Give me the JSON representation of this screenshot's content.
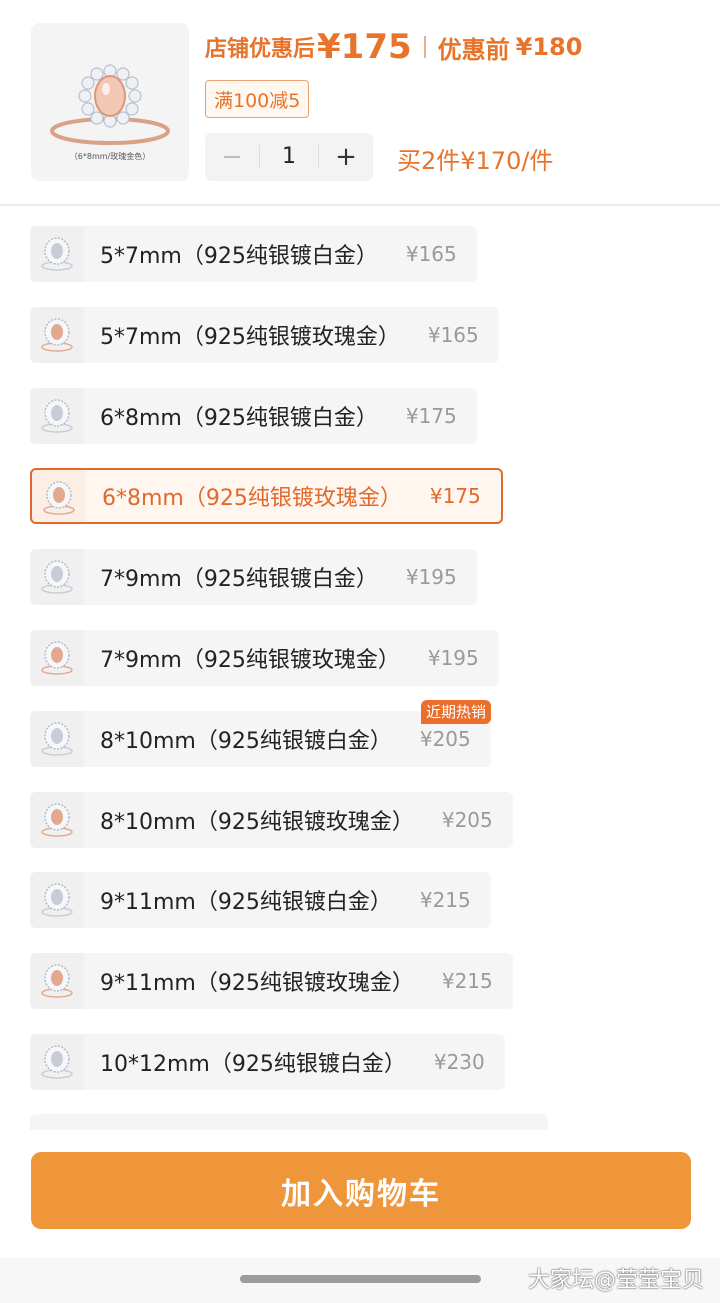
{
  "header": {
    "thumb_caption": "（6*8mm/玫瑰金色）",
    "discount_label": "店铺优惠后",
    "discount_price": "¥175",
    "original_label": "优惠前",
    "original_price": "¥180",
    "coupon": "满100减5",
    "quantity": "1",
    "minus": "−",
    "plus": "+",
    "bulk_offer": "买2件¥170/件"
  },
  "options": [
    {
      "name": "5*7mm（925纯银镀白金）",
      "price": "¥165",
      "tone": "silver",
      "selected": false
    },
    {
      "name": "5*7mm（925纯银镀玫瑰金）",
      "price": "¥165",
      "tone": "rose",
      "selected": false
    },
    {
      "name": "6*8mm（925纯银镀白金）",
      "price": "¥175",
      "tone": "silver",
      "selected": false
    },
    {
      "name": "6*8mm（925纯银镀玫瑰金）",
      "price": "¥175",
      "tone": "rose",
      "selected": true
    },
    {
      "name": "7*9mm（925纯银镀白金）",
      "price": "¥195",
      "tone": "silver",
      "selected": false
    },
    {
      "name": "7*9mm（925纯银镀玫瑰金）",
      "price": "¥195",
      "tone": "rose",
      "selected": false
    },
    {
      "name": "8*10mm（925纯银镀白金）",
      "price": "¥205",
      "tone": "silver",
      "selected": false
    },
    {
      "name": "8*10mm（925纯银镀玫瑰金）",
      "price": "¥205",
      "tone": "rose",
      "selected": false
    },
    {
      "name": "9*11mm（925纯银镀白金）",
      "price": "¥215",
      "tone": "silver",
      "selected": false
    },
    {
      "name": "9*11mm（925纯银镀玫瑰金）",
      "price": "¥215",
      "tone": "rose",
      "selected": false
    },
    {
      "name": "10*12mm（925纯银镀白金）",
      "price": "¥230",
      "tone": "silver",
      "selected": false
    }
  ],
  "hot_badge": "近期热销",
  "cart_button": "加入购物车",
  "watermark": "大家坛@莹莹宝贝",
  "colors": {
    "accent": "#e8732a",
    "button": "#f0963a",
    "silver": "#c7ccd6",
    "rose": "#e3a98f"
  }
}
